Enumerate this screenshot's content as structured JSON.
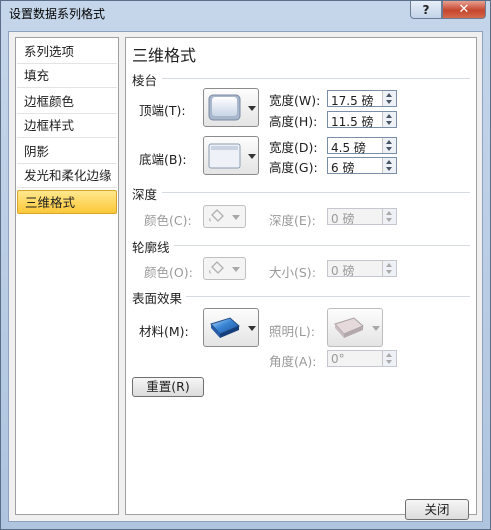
{
  "window": {
    "title": "设置数据系列格式",
    "help_label": "?",
    "close_glyph": "✕"
  },
  "sidebar": {
    "items": [
      {
        "label": "系列选项"
      },
      {
        "label": "填充"
      },
      {
        "label": "边框颜色"
      },
      {
        "label": "边框样式"
      },
      {
        "label": "阴影"
      },
      {
        "label": "发光和柔化边缘"
      },
      {
        "label": "三维格式",
        "selected": true
      }
    ]
  },
  "panel": {
    "heading": "三维格式",
    "bevel": {
      "section": "棱台",
      "top_label": "顶端(T):",
      "bottom_label": "底端(B):",
      "top_width_label": "宽度(W):",
      "top_width": "17.5 磅",
      "top_height_label": "高度(H):",
      "top_height": "11.5 磅",
      "bottom_width_label": "宽度(D):",
      "bottom_width": "4.5 磅",
      "bottom_height_label": "高度(G):",
      "bottom_height": "6 磅"
    },
    "depth": {
      "section": "深度",
      "color_label": "颜色(C):",
      "depth_label": "深度(E):",
      "depth_value": "0 磅"
    },
    "contour": {
      "section": "轮廓线",
      "color_label": "颜色(O):",
      "size_label": "大小(S):",
      "size_value": "0 磅"
    },
    "surface": {
      "section": "表面效果",
      "material_label": "材料(M):",
      "lighting_label": "照明(L):",
      "angle_label": "角度(A):",
      "angle_value": "0°"
    },
    "reset_label": "重置(R)"
  },
  "footer": {
    "close_label": "关闭"
  }
}
